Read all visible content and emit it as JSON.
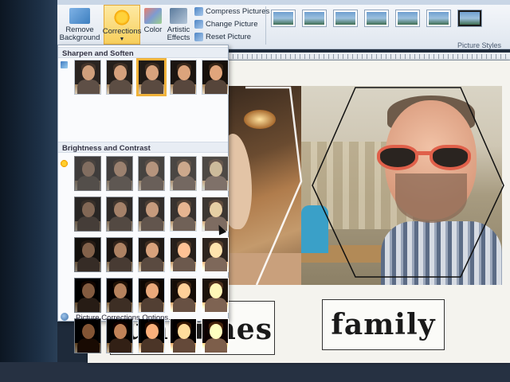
{
  "ribbon": {
    "remove_background": "Remove Background",
    "corrections": "Corrections",
    "color": "Color",
    "artistic_effects": "Artistic Effects",
    "compress_pictures": "Compress Pictures",
    "change_picture": "Change Picture",
    "reset_picture": "Reset Picture",
    "picture_styles_label": "Picture Styles"
  },
  "corrections_menu": {
    "sharpen_heading": "Sharpen and Soften",
    "brightness_heading": "Brightness and Contrast",
    "footer_option": "Picture Corrections Options...",
    "sharpen_count": 5,
    "sharpen_selected_index": 2,
    "brightness_rows": 5,
    "brightness_cols": 5
  },
  "document": {
    "word_1": "fun times",
    "word_2": "family"
  },
  "colors": {
    "selected_border": "#f0b23a",
    "sunglasses_frame": "#e0604a"
  }
}
